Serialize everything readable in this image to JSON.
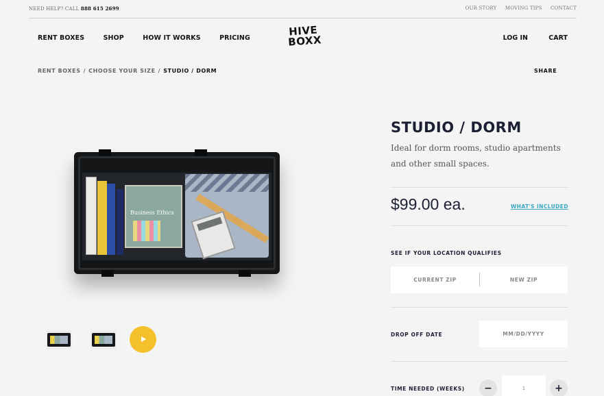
{
  "topbar": {
    "help_prefix": "NEED HELP? CALL",
    "phone": "888 615 2699",
    "links": [
      "OUR STORY",
      "MOVING TIPS",
      "CONTACT"
    ]
  },
  "nav": {
    "left": [
      "RENT BOXES",
      "SHOP",
      "HOW IT WORKS",
      "PRICING"
    ],
    "logo_line1": "HIVE",
    "logo_line2": "BOXX",
    "login": "LOG IN",
    "cart": "CART"
  },
  "breadcrumb": {
    "items": [
      "RENT BOXES",
      "CHOOSE YOUR SIZE",
      "STUDIO / DORM"
    ],
    "separator": "/"
  },
  "share_label": "SHARE",
  "product": {
    "title": "STUDIO / DORM",
    "description": "Ideal for dorm rooms, studio apartments and other small spaces.",
    "price": "$99.00 ea.",
    "whats_included": "WHAT'S INCLUDED",
    "image_text": "Business Ethics"
  },
  "location": {
    "label": "SEE IF YOUR LOCATION QUALIFIES",
    "current_zip": "CURRENT ZIP",
    "new_zip": "NEW ZIP"
  },
  "dropoff": {
    "label": "DROP OFF DATE",
    "placeholder": "MM/DD/YYYY"
  },
  "time_needed": {
    "label": "TIME NEEDED (WEEKS)",
    "minus": "−",
    "plus": "+",
    "value": "1"
  },
  "colors": {
    "accent_link": "#3aa7c4",
    "play_button": "#f4c12c",
    "heading": "#1c1f33",
    "background": "#f4f4f4"
  }
}
